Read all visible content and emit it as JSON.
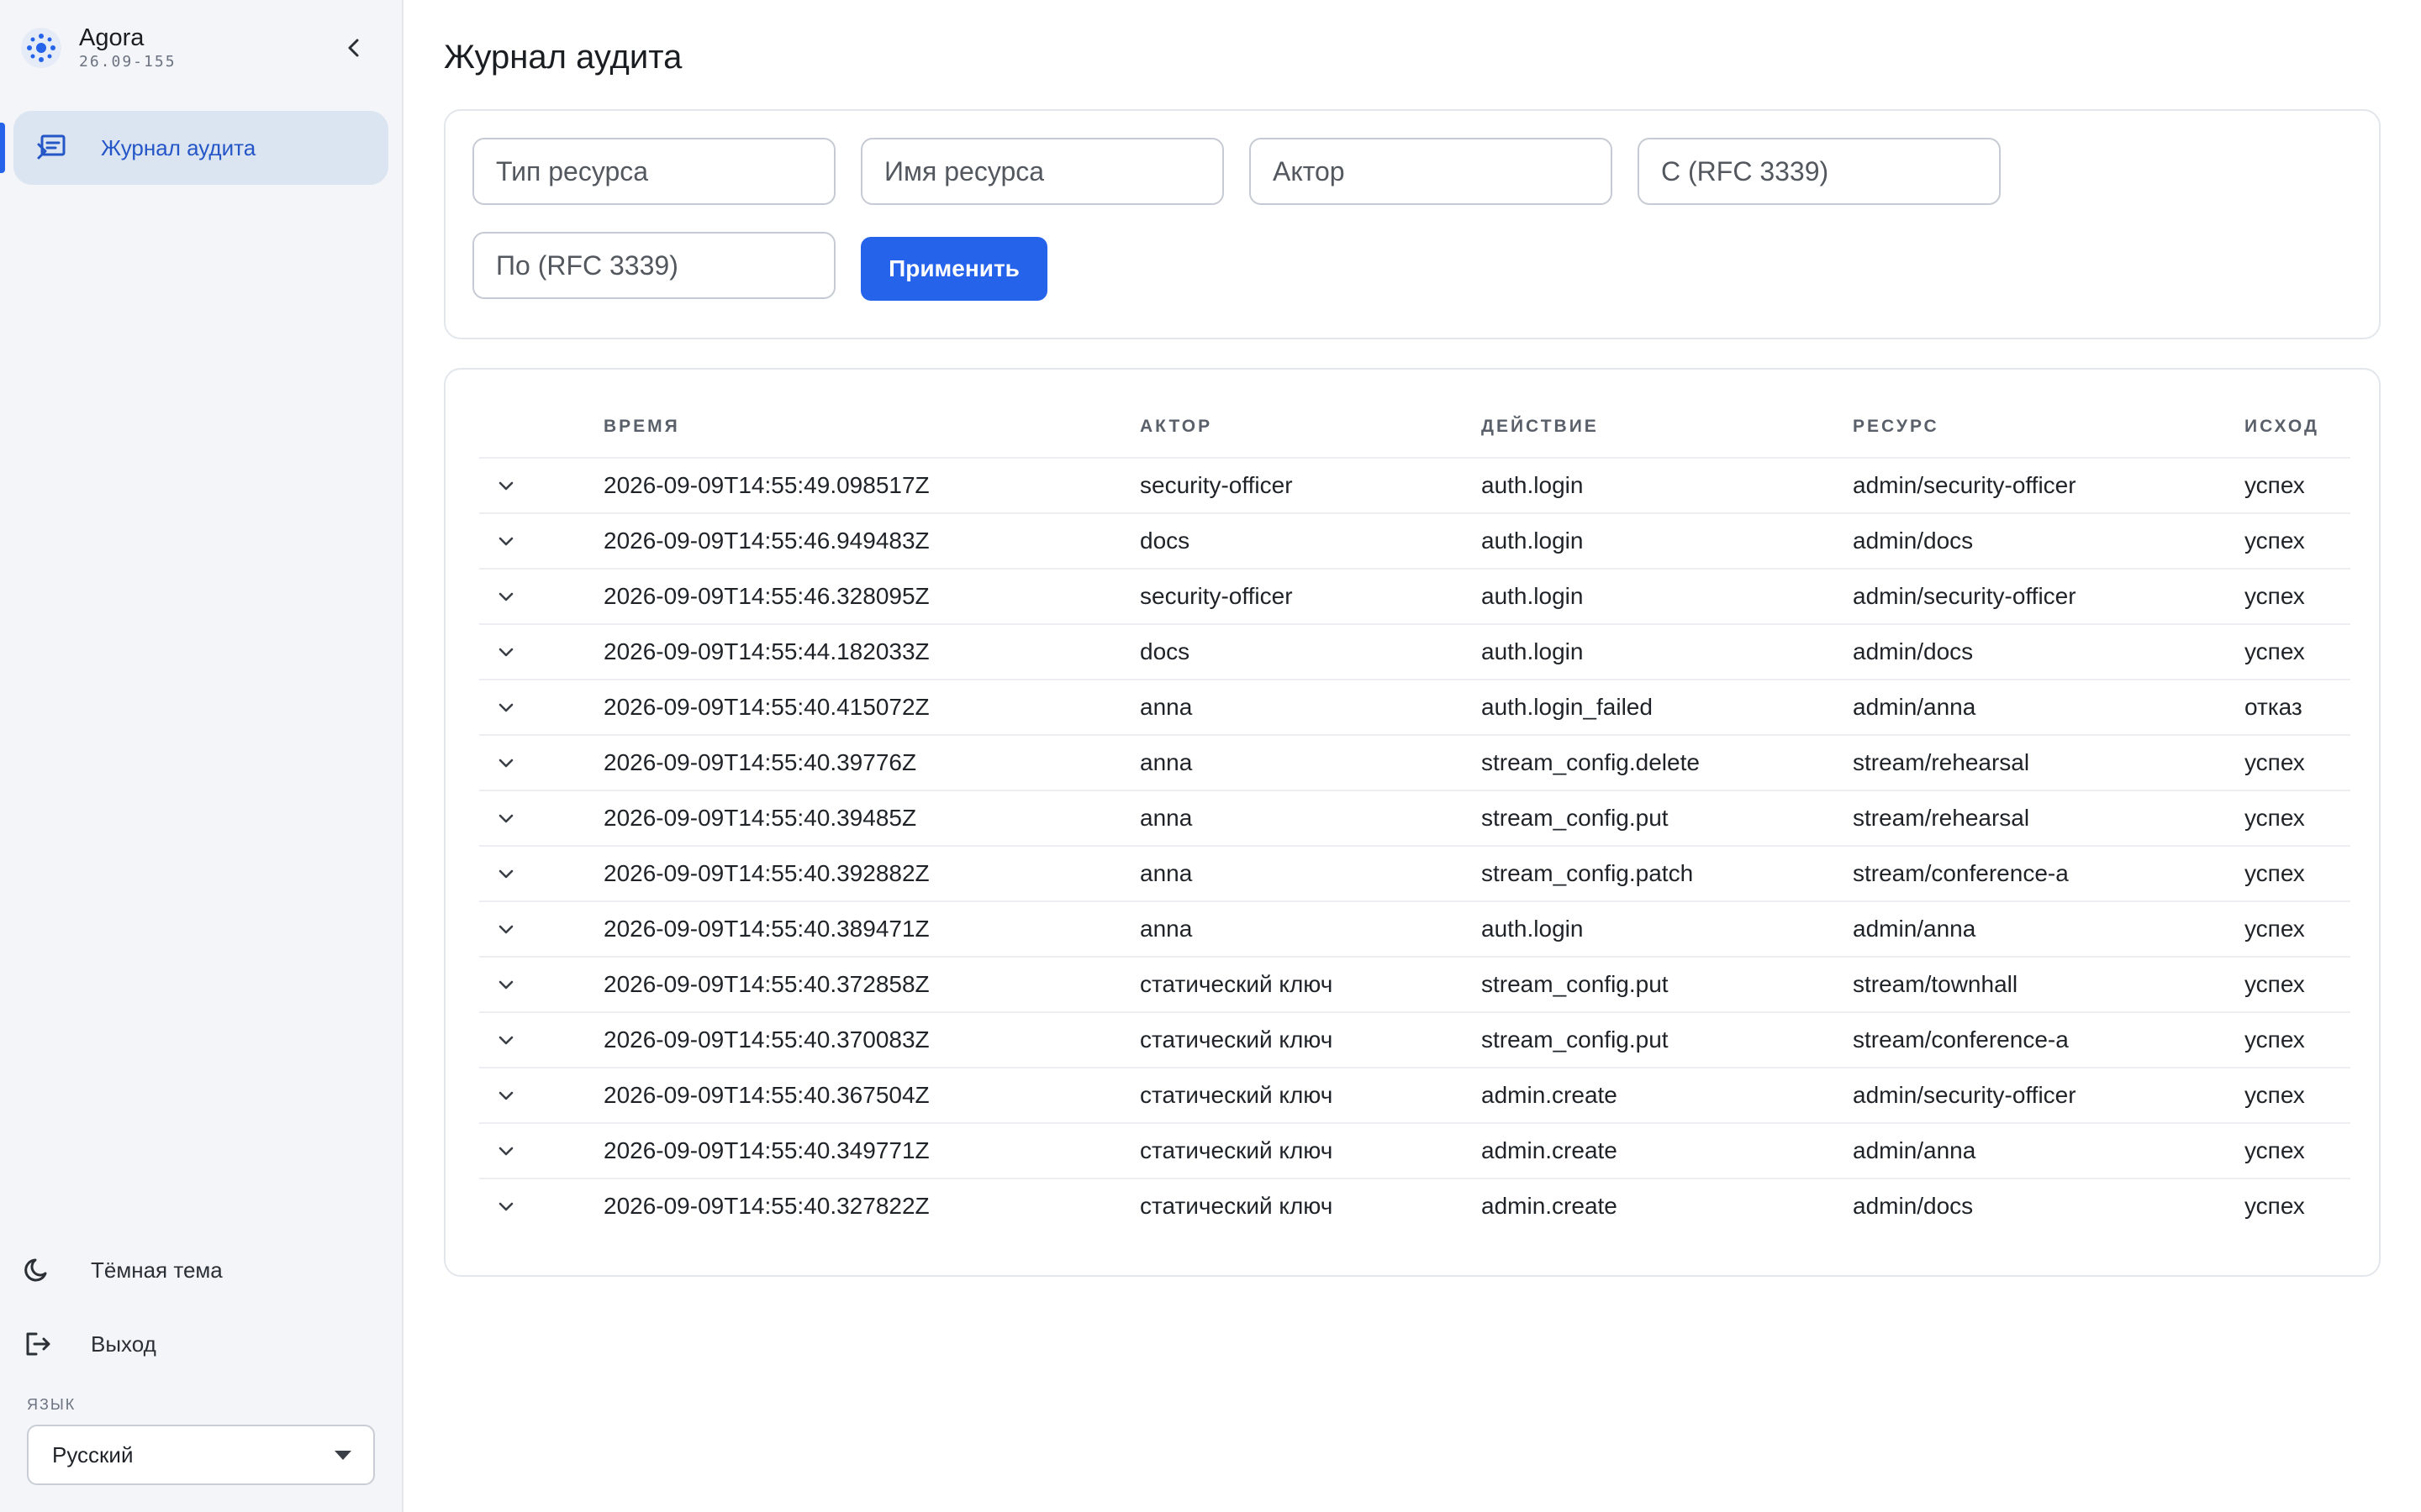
{
  "app": {
    "name": "Agora",
    "version": "26.09-155"
  },
  "sidebar": {
    "nav": [
      {
        "label": "Журнал аудита",
        "icon": "audit-log-icon",
        "active": true
      }
    ],
    "theme_label": "Тёмная тема",
    "logout_label": "Выход",
    "language_caption": "ЯЗЫК",
    "language_value": "Русский"
  },
  "page": {
    "title": "Журнал аудита"
  },
  "filters": {
    "resource_type_placeholder": "Тип ресурса",
    "resource_name_placeholder": "Имя ресурса",
    "actor_placeholder": "Актор",
    "from_placeholder": "С (RFC 3339)",
    "to_placeholder": "По (RFC 3339)",
    "apply_label": "Применить"
  },
  "table": {
    "headers": {
      "time": "ВРЕМЯ",
      "actor": "АКТОР",
      "action": "ДЕЙСТВИЕ",
      "resource": "РЕСУРС",
      "outcome": "ИСХОД"
    },
    "rows": [
      {
        "time": "2026-09-09T14:55:49.098517Z",
        "actor": "security-officer",
        "action": "auth.login",
        "resource": "admin/security-officer",
        "outcome": "успех"
      },
      {
        "time": "2026-09-09T14:55:46.949483Z",
        "actor": "docs",
        "action": "auth.login",
        "resource": "admin/docs",
        "outcome": "успех"
      },
      {
        "time": "2026-09-09T14:55:46.328095Z",
        "actor": "security-officer",
        "action": "auth.login",
        "resource": "admin/security-officer",
        "outcome": "успех"
      },
      {
        "time": "2026-09-09T14:55:44.182033Z",
        "actor": "docs",
        "action": "auth.login",
        "resource": "admin/docs",
        "outcome": "успех"
      },
      {
        "time": "2026-09-09T14:55:40.415072Z",
        "actor": "anna",
        "action": "auth.login_failed",
        "resource": "admin/anna",
        "outcome": "отказ"
      },
      {
        "time": "2026-09-09T14:55:40.39776Z",
        "actor": "anna",
        "action": "stream_config.delete",
        "resource": "stream/rehearsal",
        "outcome": "успех"
      },
      {
        "time": "2026-09-09T14:55:40.39485Z",
        "actor": "anna",
        "action": "stream_config.put",
        "resource": "stream/rehearsal",
        "outcome": "успех"
      },
      {
        "time": "2026-09-09T14:55:40.392882Z",
        "actor": "anna",
        "action": "stream_config.patch",
        "resource": "stream/conference-a",
        "outcome": "успех"
      },
      {
        "time": "2026-09-09T14:55:40.389471Z",
        "actor": "anna",
        "action": "auth.login",
        "resource": "admin/anna",
        "outcome": "успех"
      },
      {
        "time": "2026-09-09T14:55:40.372858Z",
        "actor": "статический ключ",
        "action": "stream_config.put",
        "resource": "stream/townhall",
        "outcome": "успех"
      },
      {
        "time": "2026-09-09T14:55:40.370083Z",
        "actor": "статический ключ",
        "action": "stream_config.put",
        "resource": "stream/conference-a",
        "outcome": "успех"
      },
      {
        "time": "2026-09-09T14:55:40.367504Z",
        "actor": "статический ключ",
        "action": "admin.create",
        "resource": "admin/security-officer",
        "outcome": "успех"
      },
      {
        "time": "2026-09-09T14:55:40.349771Z",
        "actor": "статический ключ",
        "action": "admin.create",
        "resource": "admin/anna",
        "outcome": "успех"
      },
      {
        "time": "2026-09-09T14:55:40.327822Z",
        "actor": "статический ключ",
        "action": "admin.create",
        "resource": "admin/docs",
        "outcome": "успех"
      }
    ]
  },
  "colors": {
    "accent": "#2563eb",
    "active_nav_bg": "#dbe4f1",
    "sidebar_bg": "#f3f5f8"
  }
}
